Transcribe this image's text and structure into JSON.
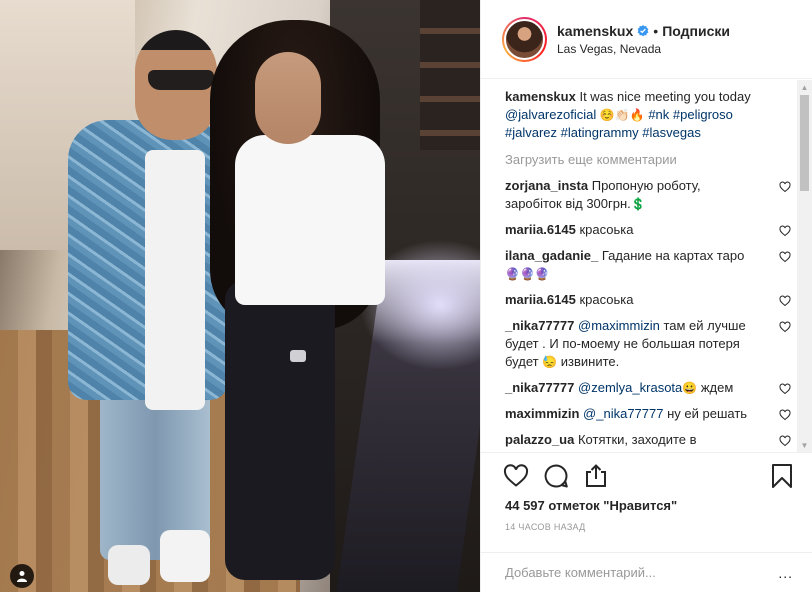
{
  "header": {
    "username": "kamenskux",
    "follow_label": "Подписки",
    "location": "Las Vegas, Nevada",
    "separator": "•"
  },
  "caption": {
    "username": "kamenskux",
    "text": "It was nice meeting you today",
    "mention": "@jalvarezoficial",
    "emojis": "☺️👏🏻🔥",
    "tags_line1": "#nk #peligroso",
    "tags_line2": "#jalvarez #latingrammy #lasvegas"
  },
  "load_more": "Загрузить еще комментарии",
  "comments": [
    {
      "user": "zorjana_insta",
      "text": "Пропоную роботу, заробіток від 300грн.",
      "emoji": "💲"
    },
    {
      "user": "mariia.6145",
      "text": "красоька",
      "emoji": ""
    },
    {
      "user": "ilana_gadanie_",
      "text": "Гадание на картах таро",
      "emoji": "🔮🔮🔮"
    },
    {
      "user": "mariia.6145",
      "text": "красоька",
      "emoji": ""
    },
    {
      "user": "_nika77777",
      "mention": "@maximmizin",
      "text": "там ей лучше будет . И по-моему не большая потеря будет",
      "emoji": "😓",
      "text2": "извините."
    },
    {
      "user": "_nika77777",
      "mention": "@zemlya_krasota",
      "text": "",
      "emoji": "😀",
      "text2": "ждем"
    },
    {
      "user": "maximmizin",
      "mention": "@_nika77777",
      "text": "ну ей решать",
      "emoji": ""
    },
    {
      "user": "palazzo_ua",
      "text": "Котятки, заходите в",
      "emoji": ""
    }
  ],
  "likes": {
    "count": "44 597",
    "label": "отметок \"Нравится\""
  },
  "time": "14 часов назад",
  "add_comment": {
    "placeholder": "Добавьте комментарий...",
    "more": "..."
  },
  "icons": {
    "like": "heart-icon",
    "comment": "comment-icon",
    "share": "share-icon",
    "save": "bookmark-icon",
    "verified": "verified-badge-icon",
    "user_tag": "user-tag-icon"
  },
  "colors": {
    "link": "#003569",
    "verified": "#3897f0",
    "muted": "#999999",
    "text": "#262626"
  }
}
